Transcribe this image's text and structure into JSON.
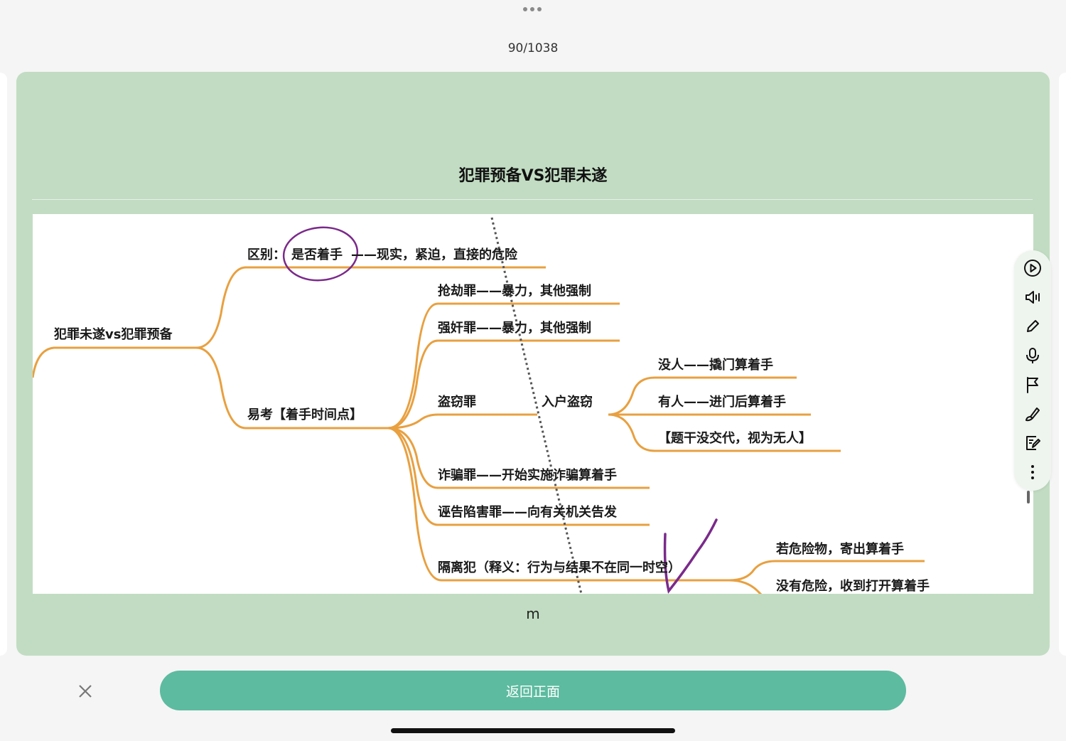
{
  "header": {
    "counter": "90/1038"
  },
  "card": {
    "title": "犯罪预备VS犯罪未遂",
    "footer_text": "m",
    "mindmap": {
      "root": "犯罪未遂vs犯罪预备",
      "branch1_label": "区别：",
      "branch1_circled": "是否着手",
      "branch1_rest": "——现实，紧迫，直接的危险",
      "branch2_label": "易考【着手时间点】",
      "items": [
        "抢劫罪——暴力，其他强制",
        "强奸罪——暴力，其他强制",
        "盗窃罪",
        "诈骗罪——开始实施诈骗算着手",
        "诬告陷害罪——向有关机关告发",
        "隔离犯（释义：行为与结果不在同一时空）"
      ],
      "theft_sub": "入户盗窃",
      "theft_leaves": [
        "没人——撬门算着手",
        "有人——进门后算着手",
        "【题干没交代，视为无人】"
      ],
      "isolation_leaves": [
        "若危险物，寄出算着手",
        "没有危险，收到打开算着手"
      ]
    }
  },
  "toolbar": {
    "icons": [
      "play-icon",
      "speaker-icon",
      "pencil-icon",
      "microphone-icon",
      "flag-icon",
      "brush-icon",
      "note-edit-icon",
      "more-icon"
    ]
  },
  "footer": {
    "back_label": "返回正面"
  },
  "colors": {
    "card_bg": "#c1dcc2",
    "button": "#5dbb9f",
    "branch": "#e8a040",
    "ink": "#7a2a8a"
  }
}
